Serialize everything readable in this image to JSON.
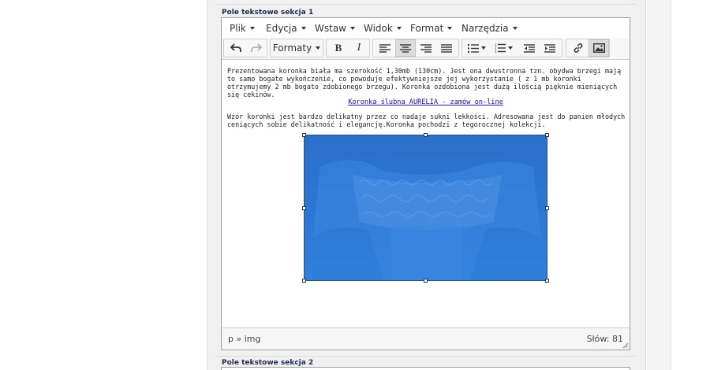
{
  "section1": {
    "title": "Pole tekstowe sekcja 1"
  },
  "section2": {
    "title": "Pole tekstowe sekcja 2"
  },
  "menubar": {
    "items": [
      {
        "label": "Plik"
      },
      {
        "label": "Edycja"
      },
      {
        "label": "Wstaw"
      },
      {
        "label": "Widok"
      },
      {
        "label": "Format"
      },
      {
        "label": "Narzędzia"
      }
    ]
  },
  "toolbar": {
    "formats_label": "Formaty",
    "bold_label": "B",
    "italic_label": "I",
    "buttons": [
      "undo",
      "redo",
      "formats",
      "bold",
      "italic",
      "align-left",
      "align-center",
      "align-right",
      "align-justify",
      "bullet-list",
      "numbered-list",
      "outdent",
      "indent",
      "link",
      "image"
    ],
    "active_button": "align-center"
  },
  "content": {
    "paragraph1": "Prezentowana koronka biała ma szerokość 1,30mb (130cm). Jest ona dwustronna tzn. obydwa brzegi mają to samo bogate wykończenie, co powoduje efektywniejsze jej wykorzystanie ( z 1 mb koronki otrzymujemy 2 mb bogato zdobionego brzegu). Koronka ozdobiona jest dużą ilością pięknie mieniących się cekinów.",
    "link_text": "Koronka ślubna AURELIA - zamów on-line",
    "paragraph2": "Wzór koronki jest bardzo delikatny przez co nadaje sukni lekkości. Adresowana jest do panien młodych ceniących sobie delikatność i elegancję.Koronka pochodzi z tegorocznej kolekcji.",
    "image": {
      "selected": true,
      "overlay_color": "#2d7ad6"
    }
  },
  "statusbar": {
    "path": "p » img",
    "word_count": "Słów: 81"
  },
  "colors": {
    "section_title": "#1f2d55",
    "link": "#1a0dab",
    "selection": "#2d7ad6",
    "panel_bg": "#f0f0f0"
  }
}
